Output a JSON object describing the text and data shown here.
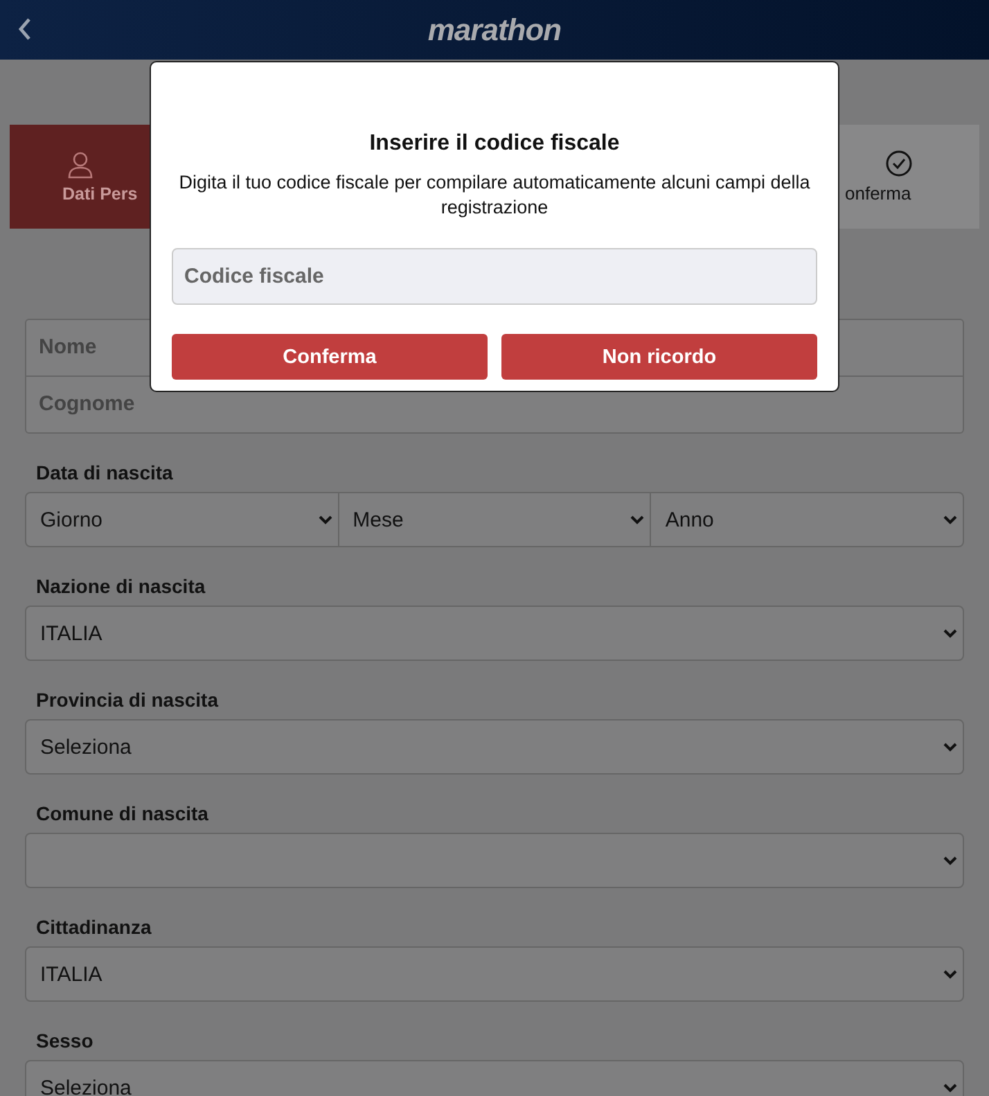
{
  "header": {
    "logo": "marathon"
  },
  "steps": [
    {
      "label": "Dati Pers",
      "kind": "person",
      "selected": true
    },
    {
      "label": "onferma",
      "kind": "check",
      "selected": false
    }
  ],
  "name_fields": [
    {
      "placeholder": "Nome"
    },
    {
      "placeholder": "Cognome"
    }
  ],
  "birth_date": {
    "label": "Data di nascita",
    "selects": [
      "Giorno",
      "Mese",
      "Anno"
    ]
  },
  "selects": [
    {
      "label": "Nazione di nascita",
      "value": "ITALIA"
    },
    {
      "label": "Provincia di nascita",
      "value": "Seleziona"
    },
    {
      "label": "Comune di nascita"
    },
    {
      "label": "Cittadinanza",
      "value": "ITALIA"
    },
    {
      "label": "Sesso",
      "value": "Seleziona"
    }
  ],
  "modal": {
    "title": "Inserire il codice fiscale",
    "text": "Digita il tuo codice fiscale per compilare automaticamente alcuni campi della registrazione",
    "input": {
      "placeholder": "Codice fiscale"
    },
    "buttons": [
      "Conferma",
      "Non ricordo"
    ]
  }
}
